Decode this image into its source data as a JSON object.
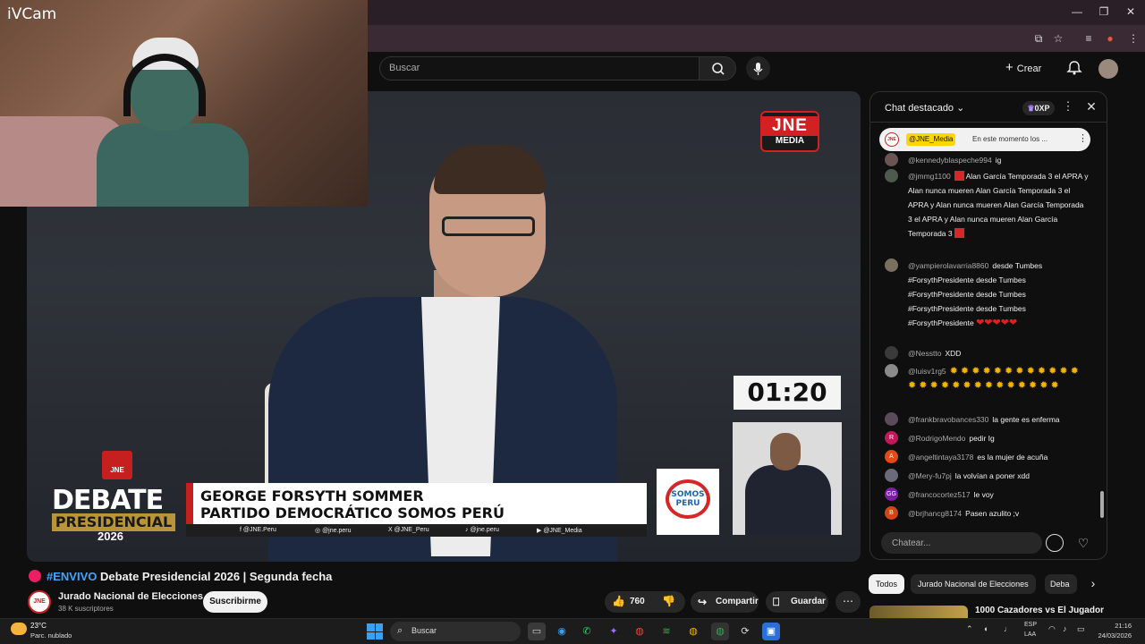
{
  "webcam": {
    "label": "iVCam"
  },
  "youtube": {
    "search_placeholder": "Buscar",
    "create_label": "Crear"
  },
  "video": {
    "logo_top": "JNE",
    "logo_bottom": "MEDIA",
    "timer": "01:20",
    "debate_badge": {
      "org": "JNE",
      "line1": "DEBATE",
      "line2": "PRESIDENCIAL",
      "year": "2026"
    },
    "name_plate": {
      "line1": "GEORGE FORSYTH SOMMER",
      "line2": "PARTIDO DEMOCRÁTICO SOMOS PERÚ"
    },
    "party_logo": "SOMOS PERU",
    "social": [
      "@JNE.Peru",
      "@jne.peru",
      "@JNE_Peru",
      "@jne.peru",
      "@JNE_Media"
    ]
  },
  "chat": {
    "title": "Chat destacado",
    "xp": "0XP",
    "pinned": {
      "user": "@JNE_Media",
      "text": "En este momento los ..."
    },
    "input_placeholder": "Chatear...",
    "messages": [
      {
        "user": "@kennedyblaspeche994",
        "text": "ig"
      },
      {
        "user": "@jmmg1100",
        "text": "Alan García Temporada 3 el APRA y Alan nunca mueren Alan García Temporada 3 el APRA y Alan nunca mueren Alan García Temporada 3 el APRA y Alan nunca mueren Alan García Temporada 3"
      },
      {
        "user": "@yampierolavarria8860",
        "text": "desde Tumbes #ForsythPresidente desde Tumbes #ForsythPresidente desde Tumbes #ForsythPresidente desde Tumbes #ForsythPresidente"
      },
      {
        "user": "@Nesstto",
        "text": "XDD"
      },
      {
        "user": "@luisv1rg5",
        "text": ""
      },
      {
        "user": "@frankbravobances330",
        "text": "la gente es enferma"
      },
      {
        "user": "@RodrigoMendo",
        "text": "pedir Ig",
        "initial": "R"
      },
      {
        "user": "@angeltintaya3178",
        "text": "es la mujer de acuña",
        "initial": "A"
      },
      {
        "user": "@Mery-fu7pj",
        "text": "la volvían a poner xdd"
      },
      {
        "user": "@francocortez517",
        "text": "le voy",
        "initial": "GG"
      },
      {
        "user": "@brjhancg8174",
        "text": "Pasen azulito ;v",
        "initial": "B"
      }
    ]
  },
  "below": {
    "title_hashtag": "#ENVIVO",
    "title_rest": " Debate Presidencial 2026 | Segunda fecha",
    "channel_name": "Jurado Nacional de Elecciones",
    "channel_subs": "38 K suscriptores",
    "channel_avatar": "JNE",
    "subscribe": "Suscribirme",
    "likes": "760",
    "share": "Compartir",
    "save": "Guardar",
    "chips": [
      "Todos",
      "Jurado Nacional de Elecciones",
      "Deba"
    ],
    "reco_title": "1000 Cazadores vs El Jugador"
  },
  "taskbar": {
    "temp": "23°C",
    "weather": "Parc. nublado",
    "search": "Buscar",
    "lang1": "ESP",
    "lang2": "LAA",
    "time": "21:16",
    "date": "24/03/2026"
  }
}
